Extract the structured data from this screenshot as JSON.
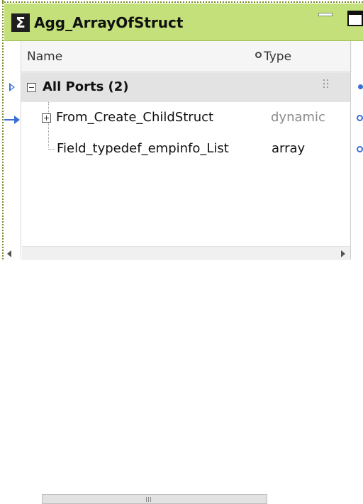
{
  "window": {
    "icon": "sigma-icon",
    "title": "Agg_ArrayOfStruct"
  },
  "columns": {
    "name_label": "Name",
    "type_label": "Type"
  },
  "group": {
    "label": "All Ports (2)"
  },
  "rows": [
    {
      "name": "From_Create_ChildStruct",
      "type": "dynamic"
    },
    {
      "name": "Field_typedef_empinfo_List",
      "type": "array"
    }
  ],
  "colors": {
    "header_bg": "#c3e07a",
    "accent_blue": "#3b6fd6",
    "group_bg": "#e3e3e3"
  }
}
